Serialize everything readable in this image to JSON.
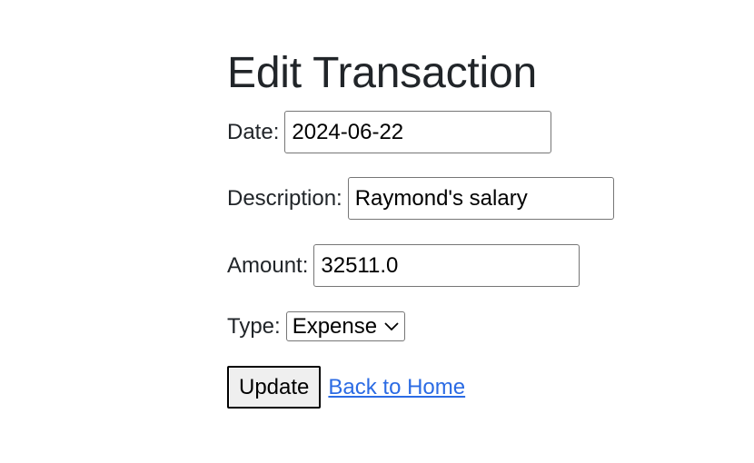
{
  "title": "Edit Transaction",
  "form": {
    "date": {
      "label": "Date:",
      "value": "2024-06-22"
    },
    "description": {
      "label": "Description:",
      "value": "Raymond's salary"
    },
    "amount": {
      "label": "Amount:",
      "value": "32511.0"
    },
    "type": {
      "label": "Type:",
      "selected": "Expense",
      "icon": "chevron-down-icon"
    }
  },
  "actions": {
    "update_label": "Update",
    "back_link": "Back to Home"
  },
  "colors": {
    "text": "#212529",
    "link": "#2b6be4",
    "button_bg": "#efefef"
  }
}
